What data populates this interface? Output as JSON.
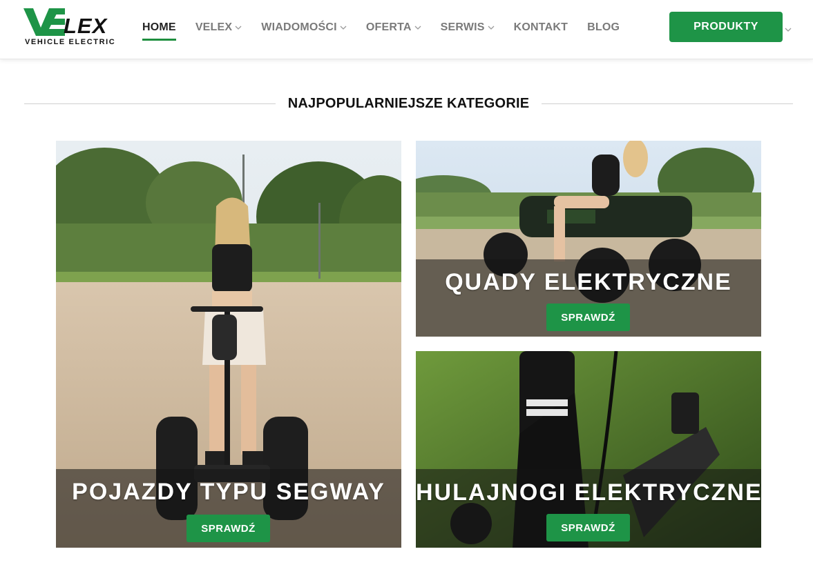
{
  "brand": {
    "name": "LEX",
    "tagline": "VEHICLE ELECTRIC",
    "colors": {
      "primary": "#1e9447",
      "dark": "#111111"
    }
  },
  "nav": {
    "items": [
      {
        "label": "HOME",
        "active": true,
        "dropdown": false
      },
      {
        "label": "VELEX",
        "active": false,
        "dropdown": true
      },
      {
        "label": "WIADOMOŚCI",
        "active": false,
        "dropdown": true
      },
      {
        "label": "OFERTA",
        "active": false,
        "dropdown": true
      },
      {
        "label": "SERWIS",
        "active": false,
        "dropdown": true
      },
      {
        "label": "KONTAKT",
        "active": false,
        "dropdown": false
      },
      {
        "label": "BLOG",
        "active": false,
        "dropdown": false
      }
    ],
    "products_button": "PRODUKTY"
  },
  "section": {
    "title": "NAJPOPULARNIEJSZE KATEGORIE"
  },
  "categories": [
    {
      "title": "POJAZDY TYPU SEGWAY",
      "button": "SPRAWDŹ"
    },
    {
      "title": "QUADY ELEKTRYCZNE",
      "button": "SPRAWDŹ"
    },
    {
      "title": "HULAJNOGI ELEKTRYCZNE",
      "button": "SPRAWDŹ"
    }
  ]
}
